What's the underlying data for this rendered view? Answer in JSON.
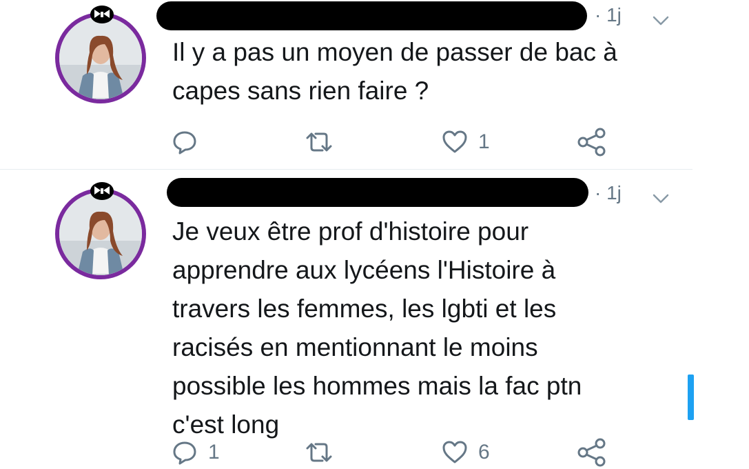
{
  "tweets": [
    {
      "time": "· 1j",
      "text_lines": [
        "Il y a pas un moyen de passer de bac à",
        "capes sans rien faire ?"
      ],
      "reply_count": "",
      "retweet_count": "",
      "like_count": "1"
    },
    {
      "time": "· 1j",
      "text_lines": [
        "Je veux être prof d'histoire pour",
        "apprendre aux lycéens l'Histoire à",
        "travers les femmes, les lgbti et les",
        "racisés en mentionnant le moins",
        "possible les hommes mais la fac ptn",
        "c'est long"
      ],
      "reply_count": "1",
      "retweet_count": "",
      "like_count": "6"
    }
  ],
  "icons": {
    "reply": "reply-icon",
    "retweet": "retweet-icon",
    "like": "heart-icon",
    "share": "share-icon",
    "caret": "chevron-down-icon",
    "badge": "bow-tie-badge-icon"
  },
  "colors": {
    "avatar_ring": "#7a2a9e",
    "icon_gray": "#657786",
    "text": "#14171a",
    "scroll_accent": "#1da1f2"
  }
}
